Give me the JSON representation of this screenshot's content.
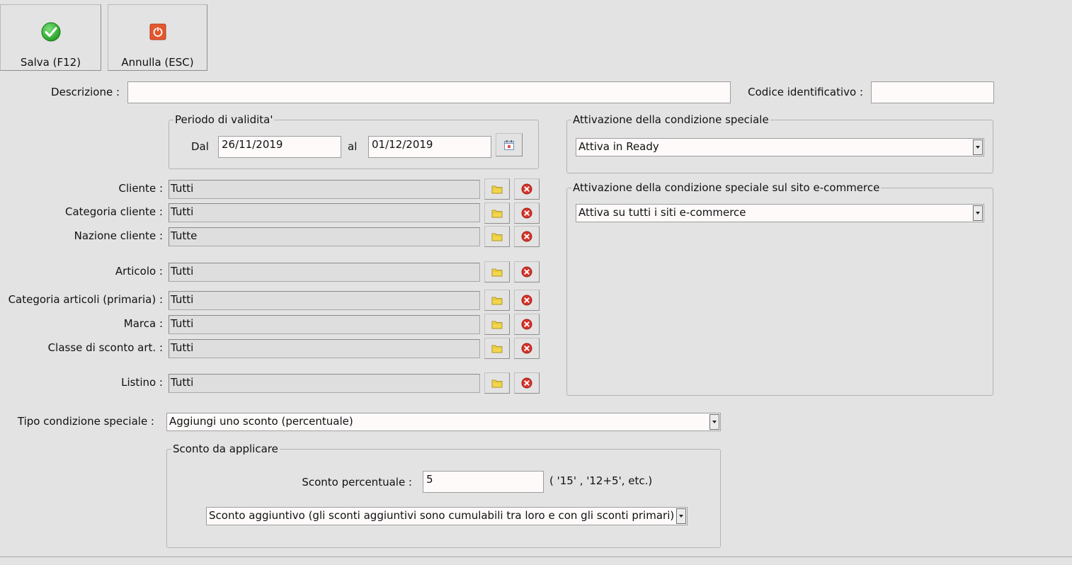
{
  "toolbar": {
    "save_label": "Salva (F12)",
    "cancel_label": "Annulla (ESC)"
  },
  "header": {
    "description_label": "Descrizione :",
    "description_value": "",
    "code_label": "Codice identificativo :",
    "code_value": ""
  },
  "validity": {
    "title": "Periodo di validita'",
    "from_label": "Dal",
    "from_value": "26/11/2019",
    "to_label": "al",
    "to_value": "01/12/2019"
  },
  "filters": [
    {
      "label": "Cliente :",
      "value": "Tutti"
    },
    {
      "label": "Categoria cliente :",
      "value": "Tutti"
    },
    {
      "label": "Nazione cliente :",
      "value": "Tutte"
    },
    {
      "label": "Articolo :",
      "value": "Tutti"
    },
    {
      "label": "Categoria articoli (primaria) :",
      "value": "Tutti"
    },
    {
      "label": "Marca :",
      "value": "Tutti"
    },
    {
      "label": "Classe di sconto art. :",
      "value": "Tutti"
    },
    {
      "label": "Listino :",
      "value": "Tutti"
    }
  ],
  "activation": {
    "title": "Attivazione della condizione speciale",
    "selected": "Attiva in Ready"
  },
  "ecommerce": {
    "title": "Attivazione della condizione speciale sul sito e-commerce",
    "selected": "Attiva su tutti i siti e-commerce"
  },
  "condition": {
    "label": "Tipo condizione speciale :",
    "selected": "Aggiungi uno sconto (percentuale)"
  },
  "discount": {
    "title": "Sconto da applicare",
    "percent_label": "Sconto percentuale :",
    "percent_value": "5",
    "hint": "( '15' ,  '12+5', etc.)",
    "mode_selected": "Sconto aggiuntivo (gli sconti aggiuntivi sono cumulabili tra loro e con gli sconti primari)"
  },
  "colors": {
    "background": "#e3e3e3",
    "field": "#fffafa",
    "save_icon": "#2fb52f",
    "cancel_icon": "#e0502a",
    "folder_icon": "#f2d64b",
    "clear_icon": "#d8342a"
  },
  "icons": {
    "save": "check-circle-icon",
    "cancel": "power-icon",
    "calendar": "calendar-icon",
    "browse": "folder-icon",
    "clear": "remove-circle-icon"
  }
}
